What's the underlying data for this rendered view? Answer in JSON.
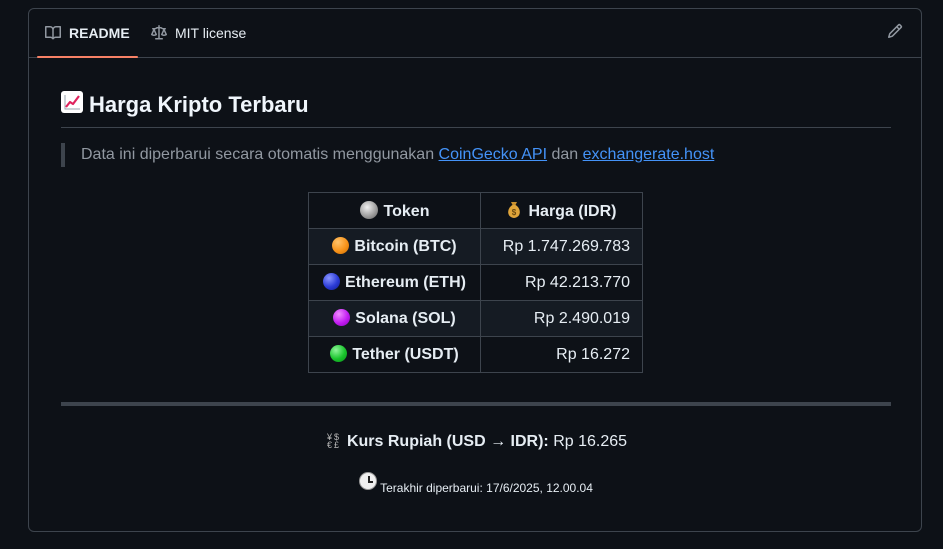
{
  "tabs": {
    "readme_label": "README",
    "license_label": "MIT license"
  },
  "icons": {
    "readme": "book-icon",
    "license": "scale-icon",
    "edit": "pencil-icon",
    "title": "chart-increasing-icon",
    "token_header": "coin-icon",
    "price_header": "money-bag-icon",
    "kurs": "currency-exchange-icon",
    "updated": "clock-icon"
  },
  "readme": {
    "title": "Harga Kripto Terbaru",
    "note_prefix": "Data ini diperbarui secara otomatis menggunakan ",
    "link1": "CoinGecko API",
    "note_mid": " dan ",
    "link2": "exchangerate.host"
  },
  "table": {
    "headers": {
      "token": "Token",
      "price": "Harga (IDR)"
    },
    "rows": [
      {
        "token": "Bitcoin (BTC)",
        "price": "Rp 1.747.269.783",
        "color": "#f7931a"
      },
      {
        "token": "Ethereum (ETH)",
        "price": "Rp 42.213.770",
        "color": "#2b3bd6"
      },
      {
        "token": "Solana (SOL)",
        "price": "Rp 2.490.019",
        "color": "#c21df2"
      },
      {
        "token": "Tether (USDT)",
        "price": "Rp 16.272",
        "color": "#19c42c"
      }
    ]
  },
  "kurs": {
    "label": "Kurs Rupiah (USD → IDR)",
    "colon": ":",
    "value": " Rp 16.265"
  },
  "updated": {
    "text": "Terakhir diperbarui: 17/6/2025, 12.00.04"
  },
  "colors": {
    "background": "#0d1117",
    "border": "#3d444d",
    "link": "#4493f8",
    "tab_underline": "#f78166"
  }
}
